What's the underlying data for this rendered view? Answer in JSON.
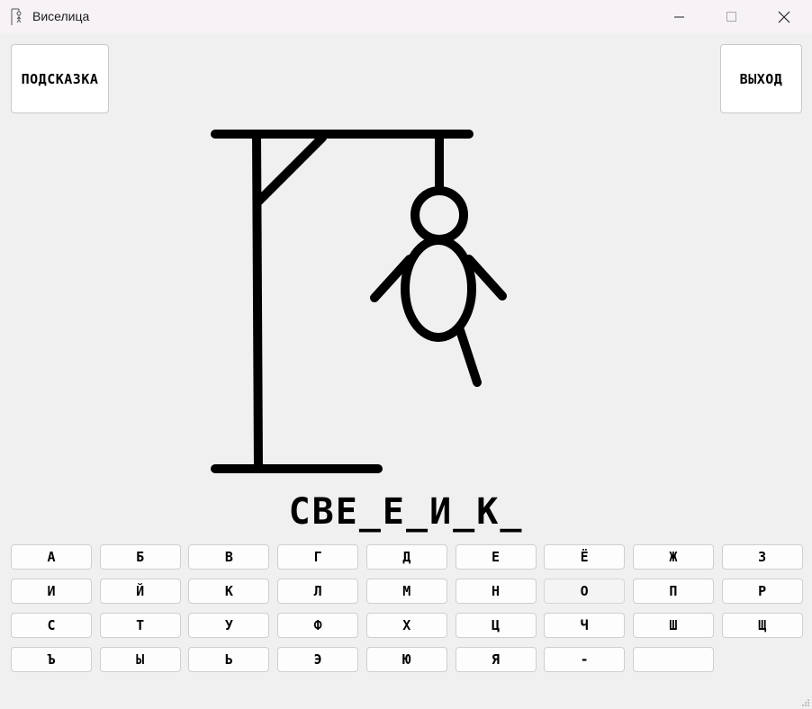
{
  "window": {
    "title": "Виселица",
    "icon": "gallows-app-icon",
    "controls": [
      "minimize-icon",
      "maximize-icon",
      "close-icon"
    ]
  },
  "buttons": {
    "hint": "ПОДСКАЗКА",
    "exit": "ВЫХОД"
  },
  "game": {
    "masked_word": "СВЕ_Е_И_К_",
    "hangman_parts_drawn": [
      "gallows",
      "rope",
      "head",
      "body",
      "left-arm",
      "right-arm",
      "right-leg"
    ]
  },
  "keyboard": {
    "rows": [
      [
        "А",
        "Б",
        "В",
        "Г",
        "Д",
        "Е",
        "Ё",
        "Ж",
        "З"
      ],
      [
        "И",
        "Й",
        "К",
        "Л",
        "М",
        "Н",
        "О",
        "П",
        "Р"
      ],
      [
        "С",
        "Т",
        "У",
        "Ф",
        "Х",
        "Ц",
        "Ч",
        "Ш",
        "Щ"
      ],
      [
        "Ъ",
        "Ы",
        "Ь",
        "Э",
        "Ю",
        "Я",
        "-",
        ""
      ]
    ],
    "used": [
      "О"
    ]
  },
  "colors": {
    "background": "#f0f0f0",
    "titlebar": "#f7f2f6",
    "ink": "#000000",
    "button": "#ffffff"
  }
}
